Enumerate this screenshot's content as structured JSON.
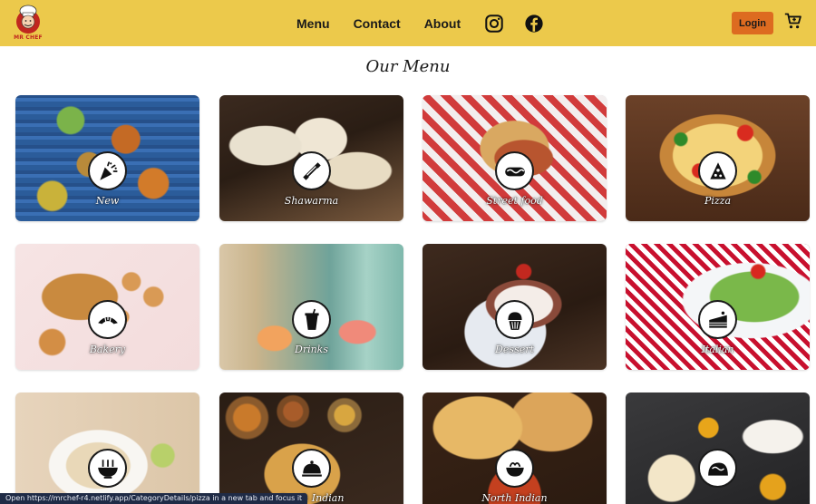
{
  "brand": {
    "logo_text": "MR CHEF",
    "icon": "chef-logo-icon"
  },
  "nav": {
    "links": [
      "Menu",
      "Contact",
      "About"
    ],
    "social": [
      "instagram-icon",
      "facebook-icon"
    ],
    "login_label": "Login",
    "cart_icon": "cart-icon"
  },
  "page": {
    "title": "Our Menu"
  },
  "categories": [
    {
      "label": "New",
      "icon": "party-popper-icon"
    },
    {
      "label": "Shawarma",
      "icon": "shawarma-icon"
    },
    {
      "label": "Street food",
      "icon": "hotdog-icon"
    },
    {
      "label": "Pizza",
      "icon": "pizza-slice-icon"
    },
    {
      "label": "Bakery",
      "icon": "croissant-icon"
    },
    {
      "label": "Drinks",
      "icon": "drink-cup-icon"
    },
    {
      "label": "Dessert",
      "icon": "cupcake-icon"
    },
    {
      "label": "Italian",
      "icon": "cake-slice-icon"
    },
    {
      "label": "",
      "icon": "ramen-bowl-icon"
    },
    {
      "label": "South Indian",
      "icon": "cloche-icon"
    },
    {
      "label": "North Indian",
      "icon": "curry-bowl-icon"
    },
    {
      "label": "",
      "icon": "taco-icon"
    }
  ],
  "status": {
    "text": "Open https://mrchef-r4.netlify.app/CategoryDetails/pizza in a new tab and focus it"
  },
  "colors": {
    "navbar": "#ecc94b",
    "login_button": "#dd6b20",
    "status_bar": "#1f2b46"
  }
}
